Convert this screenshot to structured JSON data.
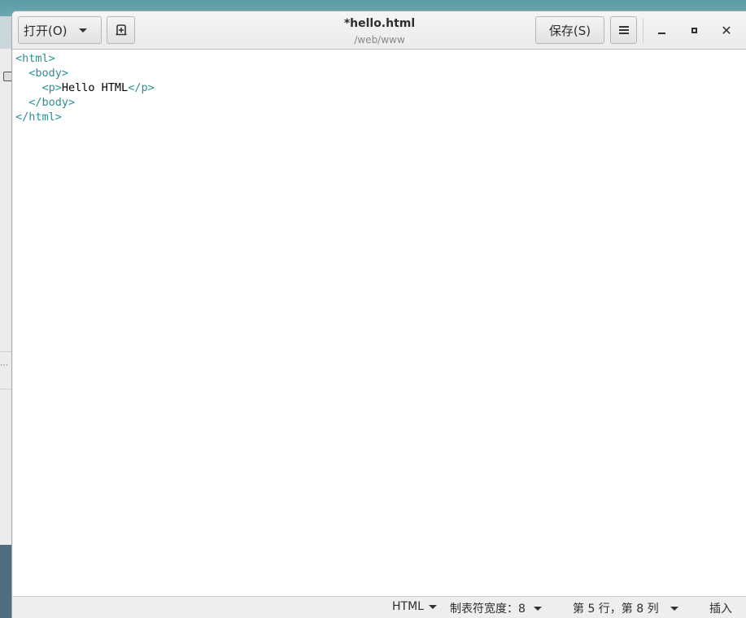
{
  "window": {
    "title": "*hello.html",
    "subtitle": "/web/www"
  },
  "toolbar": {
    "open_label": "打开(O)",
    "save_label": "保存(S)",
    "close_glyph": "✕"
  },
  "editor": {
    "lines": [
      {
        "indent": "",
        "parts": [
          {
            "t": "<html>",
            "k": "tag"
          }
        ]
      },
      {
        "indent": "  ",
        "parts": [
          {
            "t": "<body>",
            "k": "tag"
          }
        ]
      },
      {
        "indent": "    ",
        "parts": [
          {
            "t": "<p>",
            "k": "tag"
          },
          {
            "t": "Hello HTML",
            "k": "txt"
          },
          {
            "t": "</p>",
            "k": "tag"
          }
        ]
      },
      {
        "indent": "  ",
        "parts": [
          {
            "t": "</body>",
            "k": "tag"
          }
        ]
      },
      {
        "indent": "",
        "parts": [
          {
            "t": "</html>",
            "k": "tag"
          }
        ]
      }
    ]
  },
  "statusbar": {
    "language": "HTML",
    "tab_width": "制表符宽度：8",
    "position": "第 5 行，第 8 列",
    "mode": "插入"
  },
  "colors": {
    "tag": "#2a8f96",
    "text": "#000000"
  },
  "icons": {
    "new_document": "new-document-icon",
    "menu": "hamburger-menu-icon",
    "minimize": "minimize-icon",
    "maximize": "maximize-icon",
    "close": "close-icon"
  }
}
